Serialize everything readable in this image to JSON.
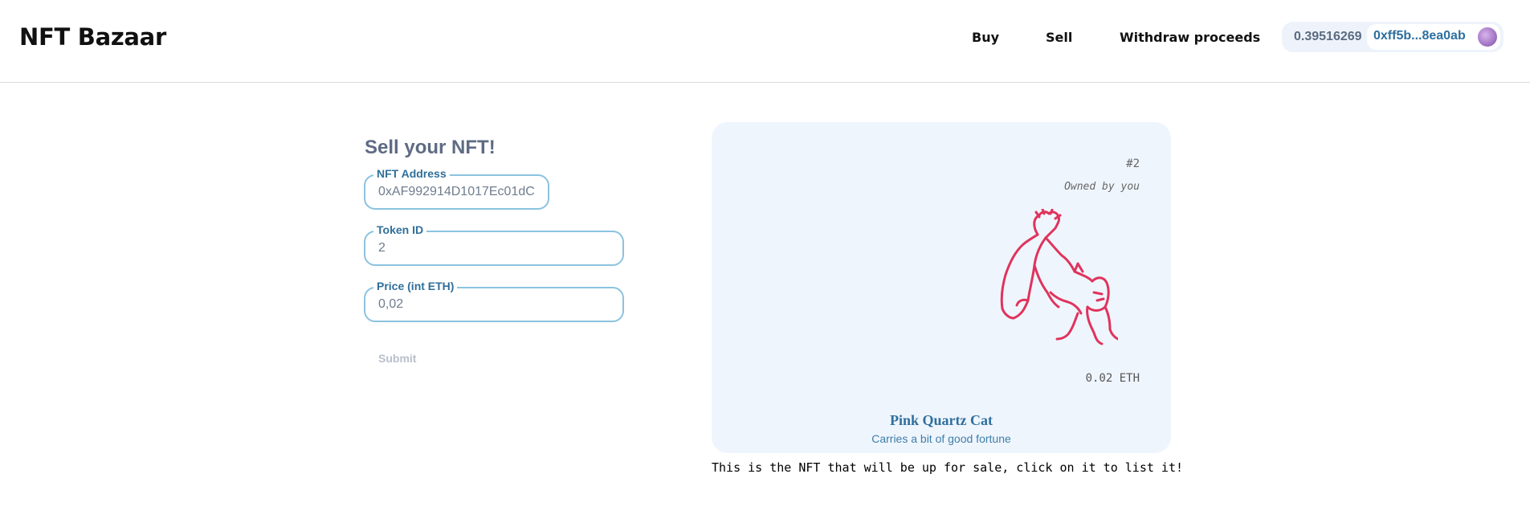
{
  "header": {
    "brand": "NFT Bazaar",
    "nav": {
      "buy": "Buy",
      "sell": "Sell",
      "withdraw": "Withdraw proceeds"
    },
    "account": {
      "balance": "0.39516269",
      "address": "0xff5b...8ea0ab",
      "avatar_icon": "avatar-icon"
    }
  },
  "form": {
    "title": "Sell your NFT!",
    "nft_address": {
      "label": "NFT Address",
      "value": "0xAF992914D1017Ec01dC"
    },
    "token_id": {
      "label": "Token ID",
      "value": "2"
    },
    "price": {
      "label": "Price (int ETH)",
      "value": "0,02"
    },
    "submit": "Submit"
  },
  "card": {
    "token_id": "#2",
    "owner": "Owned by you",
    "price": "0.02 ETH",
    "name": "Pink Quartz Cat",
    "description": "Carries a bit of good fortune",
    "image_icon": "cat-illustration",
    "accent_color": "#e0335c"
  },
  "caption": "This is the NFT that will be up for sale, click on it to list it!"
}
